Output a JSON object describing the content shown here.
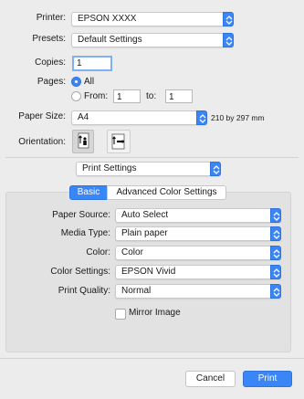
{
  "printer": {
    "label": "Printer:",
    "value": "EPSON XXXX"
  },
  "presets": {
    "label": "Presets:",
    "value": "Default Settings"
  },
  "copies": {
    "label": "Copies:",
    "value": "1"
  },
  "pages": {
    "label": "Pages:",
    "all_label": "All",
    "from_label": "From:",
    "from_value": "1",
    "to_label": "to:",
    "to_value": "1",
    "selected": "All"
  },
  "paper_size": {
    "label": "Paper Size:",
    "value": "A4",
    "dimensions": "210 by 297 mm"
  },
  "orientation": {
    "label": "Orientation:",
    "selected": "portrait"
  },
  "section_popup": {
    "value": "Print Settings"
  },
  "tabs": [
    {
      "label": "Basic",
      "selected": true
    },
    {
      "label": "Advanced Color Settings",
      "selected": false
    }
  ],
  "settings": {
    "paper_source": {
      "label": "Paper Source:",
      "value": "Auto Select"
    },
    "media_type": {
      "label": "Media Type:",
      "value": "Plain paper"
    },
    "color": {
      "label": "Color:",
      "value": "Color"
    },
    "color_settings": {
      "label": "Color Settings:",
      "value": "EPSON Vivid"
    },
    "print_quality": {
      "label": "Print Quality:",
      "value": "Normal"
    },
    "mirror_image": {
      "label": "Mirror Image",
      "checked": false
    }
  },
  "buttons": {
    "cancel": "Cancel",
    "print": "Print"
  },
  "colors": {
    "accent": "#3a86f7",
    "background": "#ececec"
  }
}
